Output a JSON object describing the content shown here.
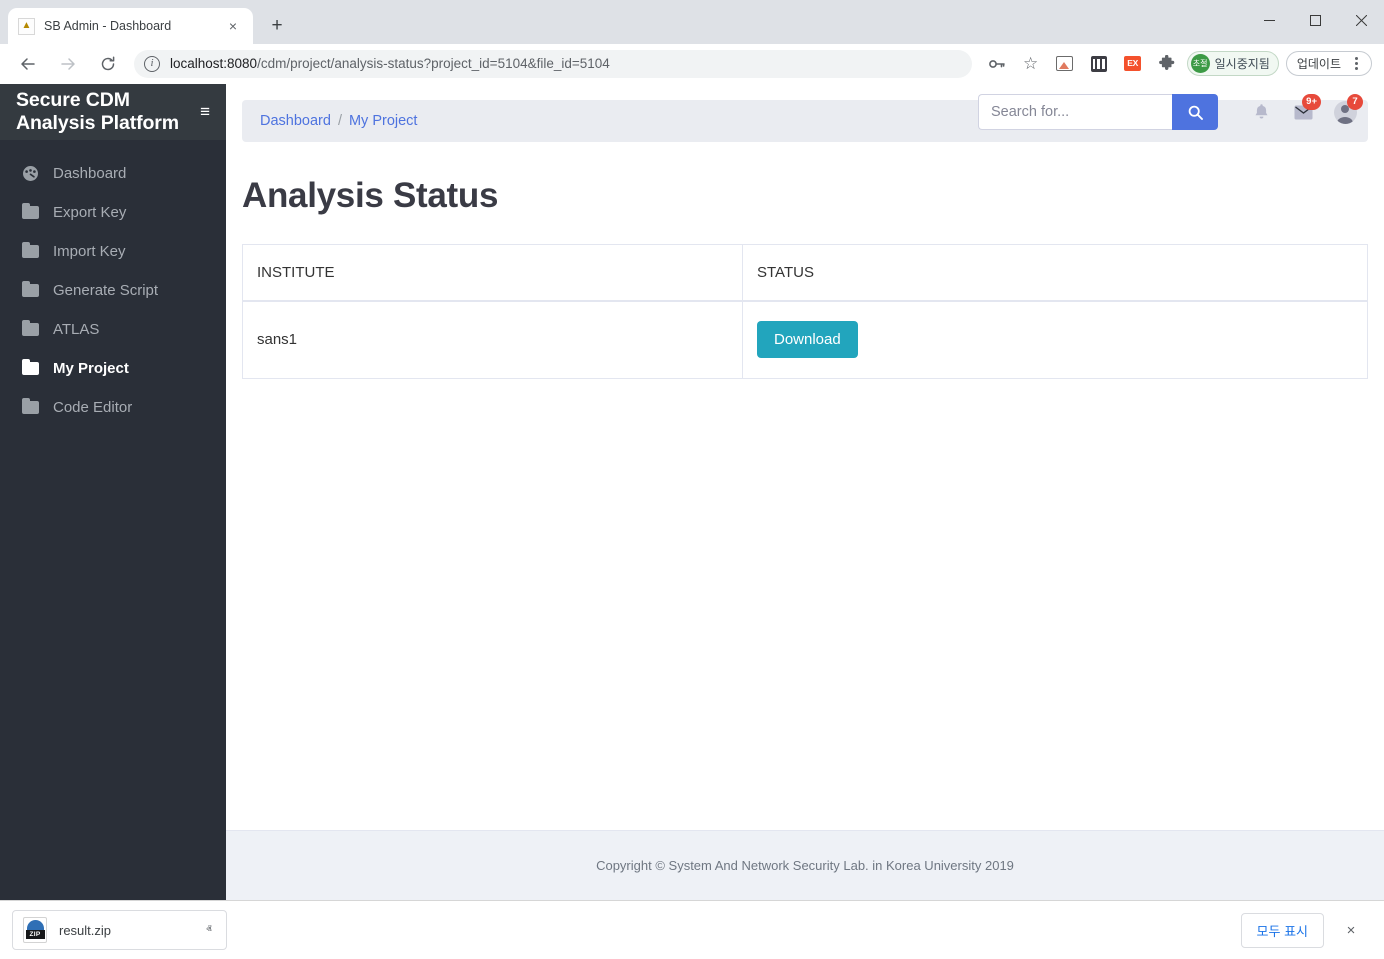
{
  "browser": {
    "tab": {
      "title": "SB Admin - Dashboard",
      "favicon": "site-favicon",
      "close": "×"
    },
    "new_tab": "+",
    "window_controls": {
      "minimize": "minimize-icon",
      "maximize": "maximize-icon",
      "close": "close-icon"
    },
    "nav": {
      "back": "←",
      "forward": "→",
      "reload": "⟳"
    },
    "omnibox": {
      "info_icon": "i",
      "host": "localhost:8080",
      "path": "/cdm/project/analysis-status?project_id=5104&file_id=5104",
      "full_url": "localhost:8080/cdm/project/analysis-status?project_id=5104&file_id=5104"
    },
    "toolbar_icons": {
      "password_key": "key-icon",
      "bookmark_star": "☆",
      "extension_image": "image-extension-icon",
      "extension_reader": "reader-extension-icon",
      "extension_ex": "EX",
      "extensions_puzzle": "puzzle-icon"
    },
    "status_pill": {
      "badge": "초절",
      "label": "일시중지됨"
    },
    "update_pill": {
      "label": "업데이트",
      "menu": "kebab-menu-icon"
    }
  },
  "downloads_bar": {
    "file_name": "result.zip",
    "file_icon": "zip-file-icon",
    "caret": "ⱏ",
    "show_all_label": "모두 표시",
    "close": "×"
  },
  "app": {
    "brand": "Secure CDM Analysis Platform",
    "brand_toggle": "≡",
    "sidebar": {
      "items": [
        {
          "label": "Dashboard",
          "icon": "tachometer-icon",
          "active": false
        },
        {
          "label": "Export Key",
          "icon": "folder-icon",
          "active": false
        },
        {
          "label": "Import Key",
          "icon": "folder-icon",
          "active": false
        },
        {
          "label": "Generate Script",
          "icon": "folder-icon",
          "active": false
        },
        {
          "label": "ATLAS",
          "icon": "folder-icon",
          "active": false
        },
        {
          "label": "My Project",
          "icon": "folder-open-icon",
          "active": true
        },
        {
          "label": "Code Editor",
          "icon": "folder-icon",
          "active": false
        }
      ]
    },
    "topbar": {
      "search_placeholder": "Search for...",
      "search_value": "",
      "search_button_icon": "search-icon",
      "alerts_icon": "bell-icon",
      "messages_icon": "envelope-icon",
      "messages_badge": "9+",
      "user_icon": "user-icon",
      "user_badge": "7"
    },
    "breadcrumb": {
      "items": [
        "Dashboard",
        "My Project"
      ],
      "separator": "/"
    },
    "page_title": "Analysis Status",
    "table": {
      "columns": [
        "INSTITUTE",
        "STATUS"
      ],
      "rows": [
        {
          "institute": "sans1",
          "action_label": "Download"
        }
      ]
    },
    "footer": "Copyright © System And Network Security Lab. in Korea University 2019",
    "colors": {
      "sidebar_bg": "#2a2f38",
      "brand_bg": "#343a40",
      "accent_blue": "#4e73df",
      "download_teal": "#22a5bd",
      "badge_red": "#e74a3b"
    }
  }
}
